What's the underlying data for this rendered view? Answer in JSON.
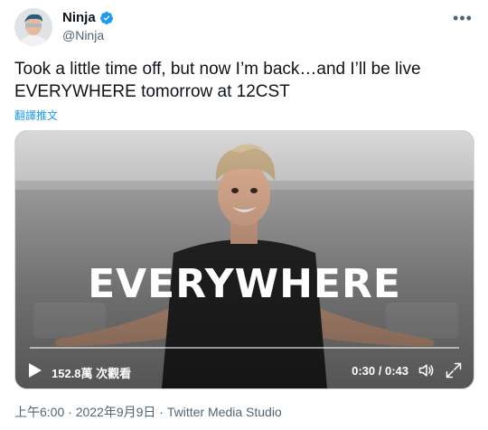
{
  "author": {
    "display_name": "Ninja",
    "handle": "@Ninja",
    "verified": true
  },
  "tweet": {
    "text": "Took a little time off, but now I’m back…and I’ll be live EVERYWHERE tomorrow at 12CST",
    "translate_label": "翻譯推文"
  },
  "video": {
    "overlay_text": "EVERYWHERE",
    "views": "152.8萬 次觀看",
    "time": "0:30 / 0:43",
    "progress": 0.7
  },
  "footer": {
    "time": "上午6:00",
    "separator": " · ",
    "date": "2022年9月9日",
    "source": "Twitter Media Studio"
  },
  "colors": {
    "link": "#1d9bf0",
    "verified": "#1d9bf0",
    "secondary_text": "#536471"
  },
  "icons": [
    "more-icon",
    "verified-badge-icon",
    "play-icon",
    "volume-icon",
    "fullscreen-icon"
  ]
}
